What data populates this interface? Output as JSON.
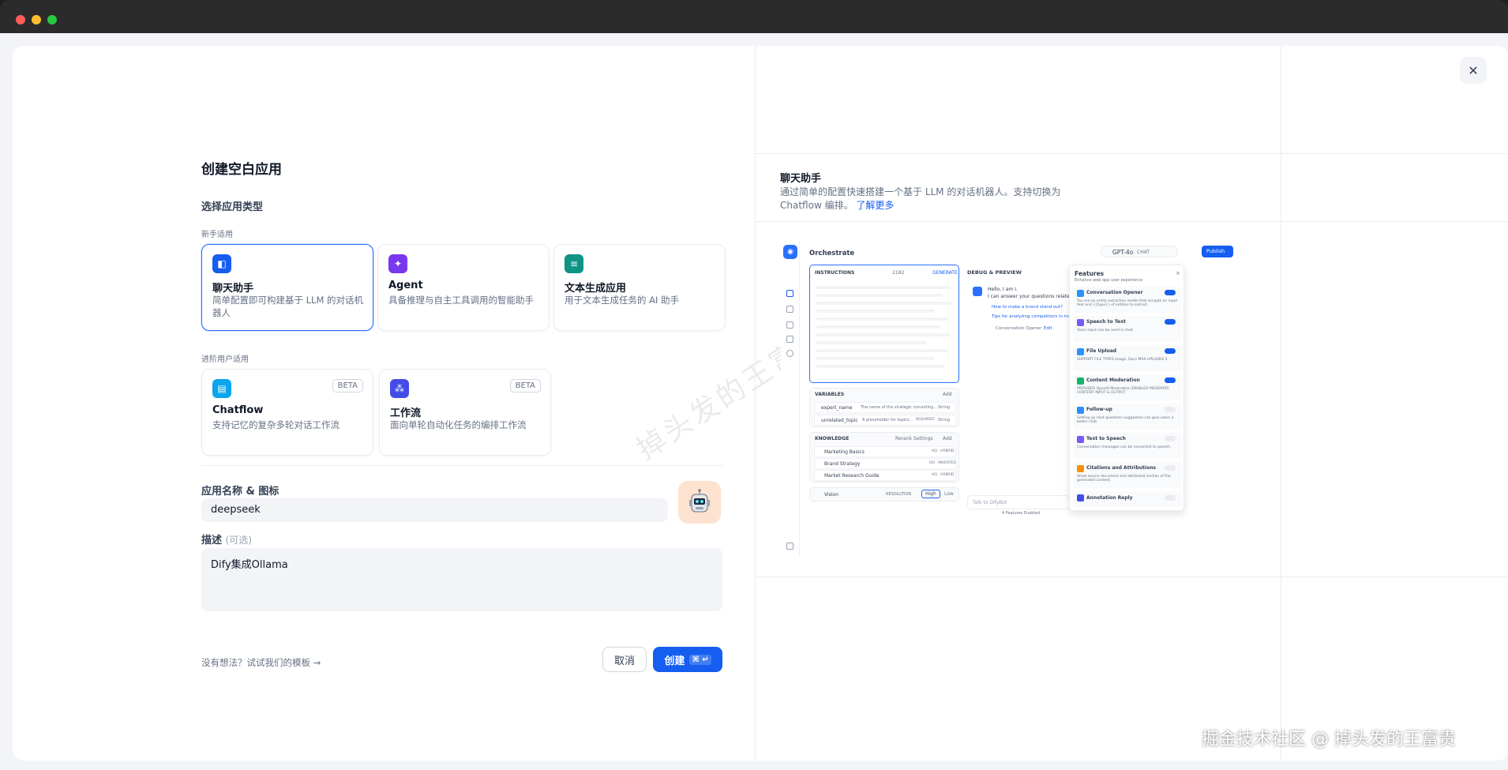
{
  "dialog": {
    "title": "创建空白应用",
    "section_app_type": "选择应用类型",
    "group_beginner": "新手适用",
    "group_advanced": "进阶用户适用",
    "cards": [
      {
        "title": "聊天助手",
        "desc": "简单配置即可构建基于 LLM 的对话机器人",
        "color": "#155eef",
        "icon": "chat-bot-icon"
      },
      {
        "title": "Agent",
        "desc": "具备推理与自主工具调用的智能助手",
        "color": "#7839ee",
        "icon": "agent-icon"
      },
      {
        "title": "文本生成应用",
        "desc": "用于文本生成任务的 AI 助手",
        "color": "#0e9384",
        "icon": "text-generator-icon"
      },
      {
        "title": "Chatflow",
        "desc": "支持记忆的复杂多轮对话工作流",
        "badge": "BETA",
        "color": "#0ba5ec",
        "icon": "chatflow-icon"
      },
      {
        "title": "工作流",
        "desc": "面向单轮自动化任务的编排工作流",
        "badge": "BETA",
        "color": "#444ce7",
        "icon": "workflow-icon"
      }
    ],
    "name_label": "应用名称 & 图标",
    "name_value": "deepseek",
    "desc_label": "描述",
    "desc_optional": "(可选)",
    "desc_value": "Dify集成Ollama",
    "template_link": "没有想法？试试我们的模板",
    "cancel": "取消",
    "create": "创建",
    "create_kbd": "⌘ ↵"
  },
  "preview": {
    "title": "聊天助手",
    "desc": "通过简单的配置快速搭建一个基于 LLM 的对话机器人。支持切换为 Chatflow 编排。",
    "learn_more": "了解更多",
    "shot": {
      "orchestrate": "Orchestrate",
      "model": "GPT-4o",
      "model_tag": "CHAT",
      "publish": "Publish",
      "instructions": "INSTRUCTIONS",
      "instructions_count": "2182",
      "generate": "GENERATE",
      "debug_preview": "DEBUG & PREVIEW",
      "bot_hello": "Hello, I am I.",
      "bot_intro": "I can answer your questions related",
      "suggest1": "How to make a brand stand out?",
      "suggest2": "Tips for analyzing competitors in market",
      "conversation_opener": "Conversation Opener",
      "edit": "Edit",
      "variables": "VARIABLES",
      "add": "Add",
      "var1_name": "expert_name",
      "var1_desc": "The name of the strategic consulting...",
      "var1_type": "String",
      "var2_name": "unrelated_topic",
      "var2_desc": "A placeholder for topics...",
      "var2_req": "REQUIRED",
      "var2_type": "String",
      "knowledge": "KNOWLEDGE",
      "rerank": "Rerank Settings",
      "kb1": "Marketing Basics",
      "kb1_tag": "HQ · HYBRID",
      "kb2": "Brand Strategy",
      "kb2_tag": "HQ · INVERTED",
      "kb3": "Market Research Guide",
      "kb3_tag": "HQ · HYBRID",
      "vision": "Vision",
      "resolution": "RESOLUTION",
      "high": "High",
      "low": "Low",
      "talk_placeholder": "Talk to DifyBot",
      "features_enabled": "4 Features Enabled",
      "features_title": "Features",
      "features_sub": "Enhance web app user experience",
      "features": [
        {
          "name": "Conversation Opener",
          "desc": "You are an entity extraction model that accepts an input text and {{type}} of entities to extract.",
          "on": true,
          "color": "#2e90fa"
        },
        {
          "name": "Speech to Text",
          "desc": "Voice input can be used in chat.",
          "on": true,
          "color": "#7a5af8"
        },
        {
          "name": "File Upload",
          "desc": "SUPPORT FILE TYPES  Image, Docs   MAX UPLOADS 3",
          "on": true,
          "color": "#2e90fa"
        },
        {
          "name": "Content Moderation",
          "desc": "PROVIDER OpenAI Moderation   ENABLED MODERATE CONTENT INPUT & OUTPUT",
          "on": true,
          "color": "#12b76a"
        },
        {
          "name": "Follow-up",
          "desc": "Setting up next questions suggestion can give users a better chat.",
          "on": false,
          "color": "#2e90fa"
        },
        {
          "name": "Text to Speech",
          "desc": "Conversation messages can be converted to speech.",
          "on": false,
          "color": "#7a5af8"
        },
        {
          "name": "Citations and Attributions",
          "desc": "Show source document and attributed section of the generated content.",
          "on": false,
          "color": "#f79009"
        },
        {
          "name": "Annotation Reply",
          "desc": "",
          "on": false,
          "color": "#444ce7"
        }
      ]
    }
  },
  "watermark": "掉头发的王富贵",
  "credit": "掘金技术社区 @ 掉头发的王富贵"
}
